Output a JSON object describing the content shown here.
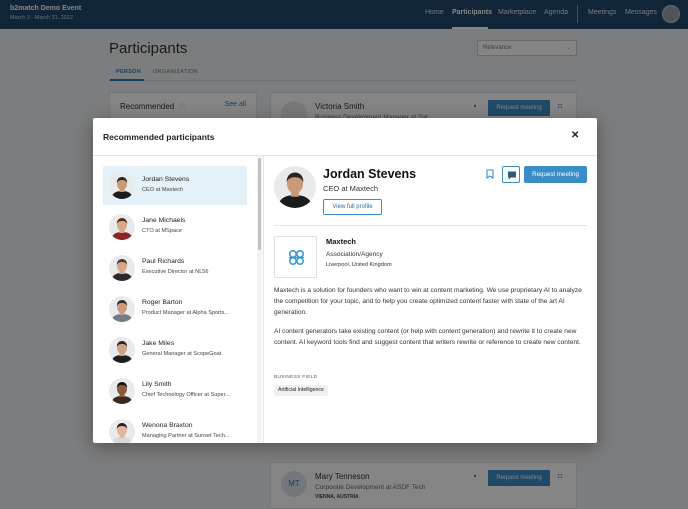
{
  "topbar": {
    "event_title": "b2match Demo Event",
    "event_dates": "March 3 - March 31, 2022",
    "nav": [
      "Home",
      "Participants",
      "Marketplace",
      "Agenda",
      "Meetings",
      "Messages"
    ],
    "active_nav": "Participants"
  },
  "page": {
    "title": "Participants",
    "sort_value": "Relevance",
    "tabs": [
      "PERSON",
      "ORGANIZATION"
    ],
    "recommended_heading": "Recommended",
    "see_all": "See all"
  },
  "background_cards": [
    {
      "initials": "",
      "name": "Victoria Smith",
      "title": "Business Development Manager at Sat...",
      "location": "",
      "request_label": "Request meeting"
    },
    {
      "initials": "MT",
      "name": "Mary Tenneson",
      "title": "Corporate Development at ASDF Tech",
      "location": "VIENNA, AUSTRIA",
      "request_label": "Request meeting"
    }
  ],
  "modal": {
    "title": "Recommended participants",
    "close_glyph": "✕",
    "people": [
      {
        "name": "Jordan Stevens",
        "title": "CEO at Maxtech",
        "skin": "#c99a7a",
        "hair": "#2a2522",
        "shirt": "#1c1c1c"
      },
      {
        "name": "Jane Michaels",
        "title": "CTO at MSpace",
        "skin": "#d9a78c",
        "hair": "#5a2e1f",
        "shirt": "#8b2327"
      },
      {
        "name": "Paul Richards",
        "title": "Executive Director at NL56",
        "skin": "#d5a688",
        "hair": "#4a3a2f",
        "shirt": "#2b2b2b"
      },
      {
        "name": "Roger Barton",
        "title": "Product Manager at Alpha Sports...",
        "skin": "#c99c80",
        "hair": "#3b2d25",
        "shirt": "#6f7f88"
      },
      {
        "name": "Jake Miles",
        "title": "General Manager at ScopeGoat",
        "skin": "#cfa283",
        "hair": "#2e2622",
        "shirt": "#1e1e1e"
      },
      {
        "name": "Lily Smith",
        "title": "Chief Technology Officer at Super...",
        "skin": "#8a5a3c",
        "hair": "#1d1412",
        "shirt": "#3a2a22"
      },
      {
        "name": "Wenona Braxton",
        "title": "Managing Partner at Sunset Tech...",
        "skin": "#e0b79d",
        "hair": "#2a1f1b",
        "shirt": "#d9d9d9"
      }
    ],
    "selected": {
      "name": "Jordan Stevens",
      "title": "CEO at Maxtech",
      "view_profile": "View full profile",
      "request_meeting": "Request meeting",
      "company": {
        "name": "Maxtech",
        "type": "Association/Agency",
        "location": "Liverpool, United Kingdom"
      },
      "description": [
        "Maxtech is a solution for founders who want to win at content marketing. We use proprietary AI to analyze the competition for your topic, and to help you create optimized content faster with state of the art AI generation.",
        "AI content generators take existing content (or help with content generation) and rewrite it to create new content. AI keyword tools find and suggest content that writers rewrite or reference to create new content."
      ],
      "business_field_label": "BUSINESS FIELD",
      "business_field": "Artificial Intelligence"
    }
  },
  "colors": {
    "primary": "#3a8ec8",
    "topbar": "#1f4a6b",
    "selected_row": "#e4f1f9"
  }
}
